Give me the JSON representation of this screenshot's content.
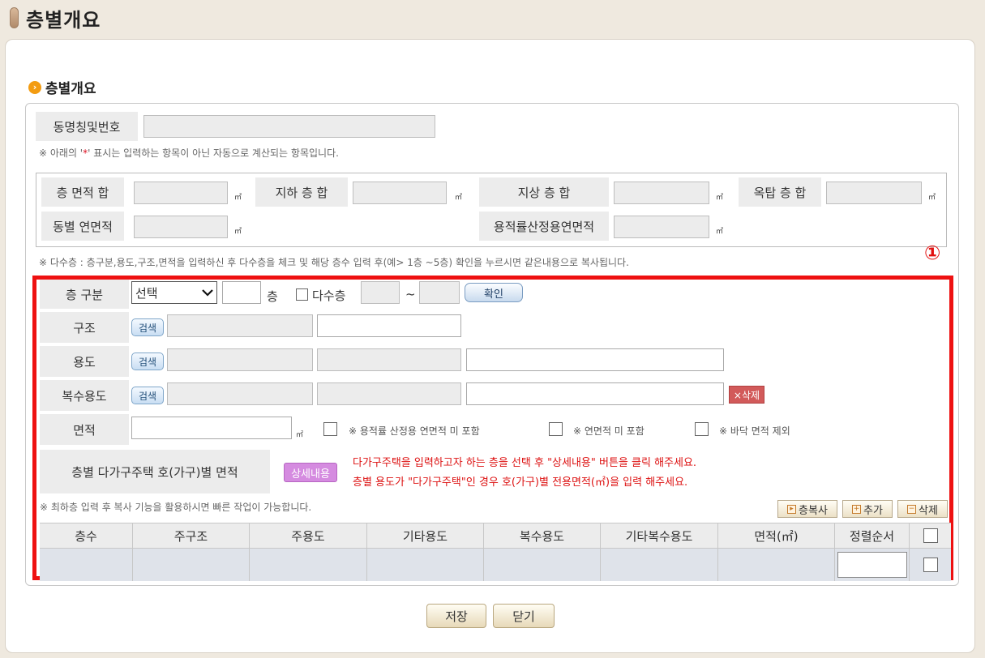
{
  "page": {
    "title": "층별개요"
  },
  "section": {
    "title": "층별개요",
    "bullet": "›"
  },
  "building": {
    "name_label": "동명칭및번호",
    "name_value": "",
    "auto_note_prefix": "※ 아래의 '",
    "auto_note_star": "*",
    "auto_note_suffix": "' 표시는 입력하는 항목이 아닌 자동으로 계산되는 항목입니다."
  },
  "summary": {
    "unit": "㎡",
    "total_area_label": "층 면적 합",
    "basement_total_label": "지하 층 합",
    "above_total_label": "지상 층 합",
    "rooftop_total_label": "옥탑 층 합",
    "building_total_area_label": "동별 연면적",
    "far_area_label": "용적률산정용연면적"
  },
  "multi_note": "※ 다수층 : 층구분,용도,구조,면적을 입력하신 후 다수층을 체크 및 해당 층수 입력 후(예> 1층 ~5층) 확인을 누르시면 같은내용으로 복사됩니다.",
  "marker": "①",
  "form": {
    "floor_type_label": "층 구분",
    "floor_select": "선택",
    "floor_suffix": "층",
    "multi_floor_label": "다수층",
    "tilde": "~",
    "confirm_button": "확인",
    "structure_label": "구조",
    "usage_label": "용도",
    "multi_usage_label": "복수용도",
    "search_button": "검색",
    "delete_button": "×삭제",
    "area_label": "면적",
    "area_unit": "㎡",
    "opt1": "※ 용적률 산정용 연면적 미 포함",
    "opt2": "※ 연면적 미 포함",
    "opt3": "※ 바닥 면적 제외",
    "household_label": "층별 다가구주택 호(가구)별 면적",
    "detail_button": "상세내용",
    "household_note1": "다가구주택을 입력하고자 하는 층을 선택 후 \"상세내용\" 버튼을 클릭 해주세요.",
    "household_note2": "층별 용도가 \"다가구주택\"인 경우 호(가구)별 전용면적(㎡)을 입력 해주세요."
  },
  "list": {
    "hint": "※ 최하층 입력 후 복사 기능을 활용하시면 빠른 작업이 가능합니다.",
    "copy_button": "층복사",
    "add_button": "추가",
    "delete_button": "삭제",
    "columns": [
      "층수",
      "주구조",
      "주용도",
      "기타용도",
      "복수용도",
      "기타복수용도",
      "면적(㎡)",
      "정렬순서"
    ]
  },
  "footer": {
    "save_button": "저장",
    "close_button": "닫기"
  }
}
